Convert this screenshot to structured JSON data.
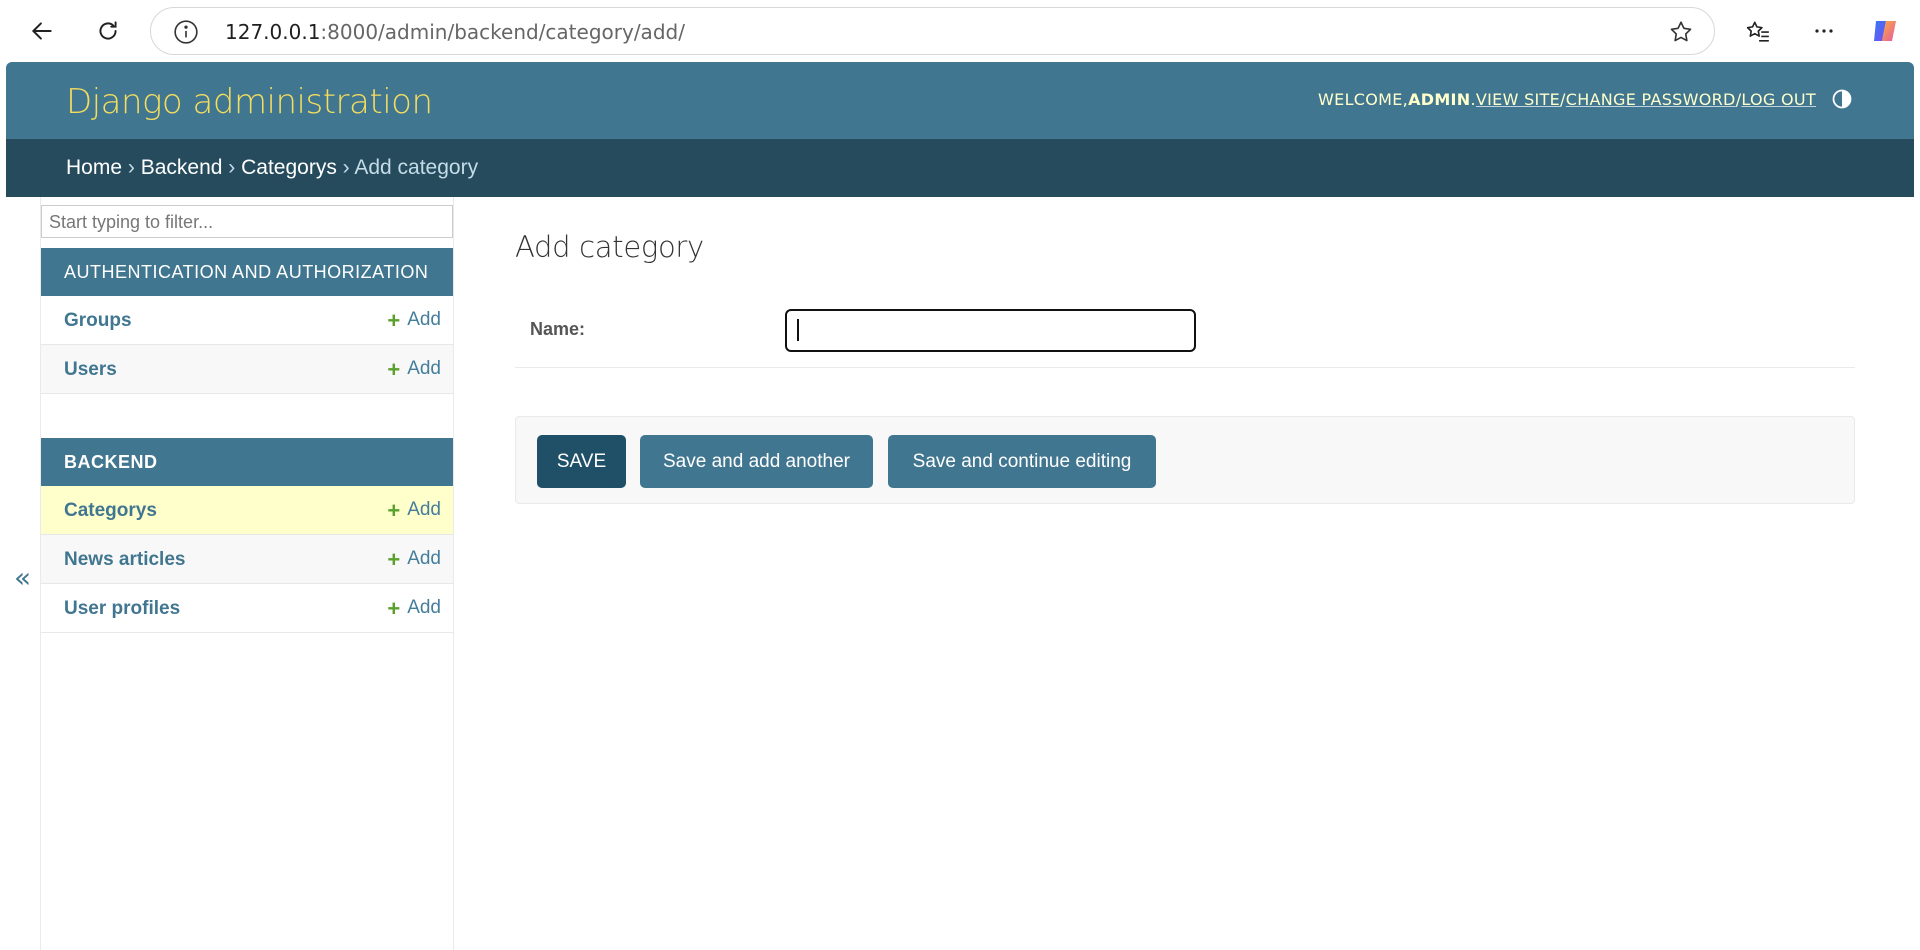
{
  "browser": {
    "url_host": "127.0.0.1",
    "url_rest": ":8000/admin/backend/category/add/"
  },
  "header": {
    "brand": "Django administration",
    "welcome": "WELCOME, ",
    "username": "ADMIN",
    "view_site": "VIEW SITE",
    "change_password": "CHANGE PASSWORD",
    "log_out": "LOG OUT",
    "sep1": ". ",
    "sep2": " / ",
    "sep3": " / "
  },
  "breadcrumbs": {
    "home": "Home",
    "backend": "Backend",
    "categorys": "Categorys",
    "current": "Add category",
    "separator": " › "
  },
  "sidebar": {
    "filter_placeholder": "Start typing to filter...",
    "toggle_glyph": "«",
    "modules": [
      {
        "caption": "AUTHENTICATION AND AUTHORIZATION",
        "models": [
          {
            "name": "Groups",
            "add": "Add"
          },
          {
            "name": "Users",
            "add": "Add"
          }
        ]
      },
      {
        "caption": "BACKEND",
        "models": [
          {
            "name": "Categorys",
            "add": "Add"
          },
          {
            "name": "News articles",
            "add": "Add"
          },
          {
            "name": "User profiles",
            "add": "Add"
          }
        ]
      }
    ]
  },
  "main": {
    "title": "Add category",
    "fields": [
      {
        "label": "Name:",
        "value": ""
      }
    ],
    "buttons": {
      "save": "SAVE",
      "save_add_another": "Save and add another",
      "save_continue": "Save and continue editing"
    }
  },
  "colors": {
    "header_bg": "#417690",
    "breadcrumb_bg": "#264b5d",
    "brand_yellow": "#f5dd5d",
    "add_green": "#5aa02c",
    "current_row": "#ffffcc",
    "primary_button": "#205067"
  },
  "icons": {
    "back": "arrow-left-icon",
    "refresh": "refresh-icon",
    "info": "info-icon",
    "favorite": "star-icon",
    "favorites": "favorites-list-icon",
    "more": "more-dots-icon",
    "copilot": "copilot-icon",
    "theme": "theme-toggle-icon"
  }
}
